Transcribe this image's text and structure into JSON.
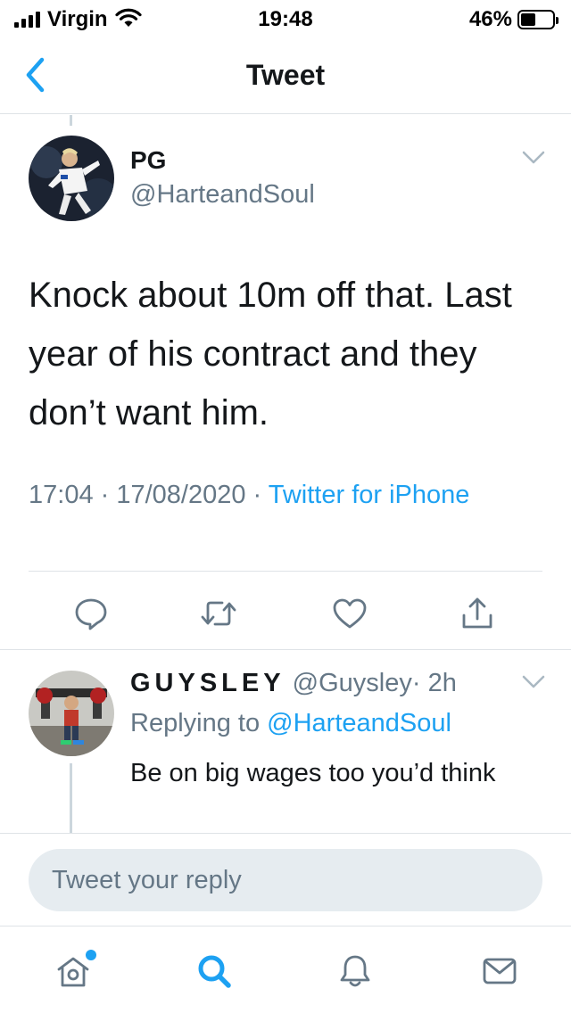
{
  "status_bar": {
    "carrier": "Virgin",
    "time": "19:48",
    "battery_percent": "46%",
    "battery_level": 0.46,
    "icons": [
      "signal-bars-icon",
      "wifi-icon",
      "battery-icon"
    ]
  },
  "nav": {
    "title": "Tweet",
    "back_icon": "chevron-left-icon"
  },
  "tweet": {
    "author_name": "PG",
    "author_handle": "@HarteandSoul",
    "text": "Knock about 10m off that. Last year of his contract and they don’t want him.",
    "timestamp": "17:04 · 17/08/2020 · ",
    "source": "Twitter for iPhone",
    "actions": [
      "reply-icon",
      "retweet-icon",
      "like-icon",
      "share-icon"
    ]
  },
  "reply": {
    "author_name": "GUYSLEY",
    "author_handle": "@Guysley",
    "time": "· 2h",
    "replying_prefix": "Replying to ",
    "replying_to": "@HarteandSoul",
    "text": "Be on big wages too you’d think"
  },
  "composer": {
    "placeholder": "Tweet your reply"
  },
  "tab_bar": {
    "tabs": [
      "home-icon",
      "search-icon",
      "notifications-icon",
      "messages-icon"
    ],
    "active": "search-icon"
  },
  "colors": {
    "accent": "#1da1f2",
    "secondary_text": "#657786",
    "primary_text": "#14171a",
    "divider": "#dfe3e7",
    "composer_bg": "#e6ecf0"
  }
}
